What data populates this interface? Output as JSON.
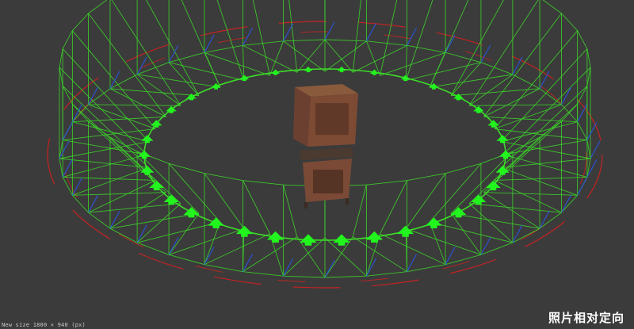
{
  "viewport": {
    "status_text": "New size 1800 × 940 (px)",
    "caption": "照片相对定向",
    "object": "point-cloud-cabinet",
    "colors": {
      "background": "#3b3b3b",
      "camera_frustum": "#3cdc28",
      "camera_marker": "#22f51e",
      "orbit_red": "#d42020",
      "axis_blue": "#2a55e0"
    }
  }
}
